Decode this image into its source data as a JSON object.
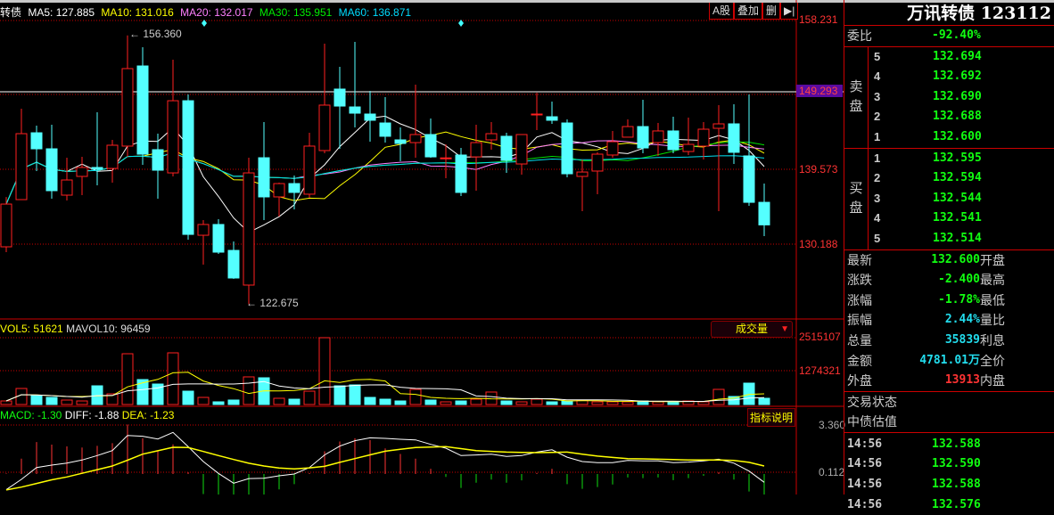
{
  "header": {
    "prefix": "转债",
    "ma": [
      {
        "label": "MA5: 127.885",
        "color": "#ffffff"
      },
      {
        "label": "MA10: 131.016",
        "color": "#ffff00"
      },
      {
        "label": "MA20: 132.017",
        "color": "#ff80ff"
      },
      {
        "label": "MA30: 135.951",
        "color": "#00e000"
      },
      {
        "label": "MA60: 136.871",
        "color": "#00e0f0"
      }
    ]
  },
  "toolbar": {
    "a_share": "A股",
    "overlay": "叠加",
    "delete": "删",
    "expand_icon": "▶|"
  },
  "price_axis": {
    "p1": "158.231",
    "p2": "149.293",
    "p3": "139.573",
    "p4": "130.188"
  },
  "annotations": {
    "high": "156.360",
    "low": "122.675"
  },
  "volume": {
    "legend_vol5": "VOL5: 51621",
    "legend_mavol10": "MAVOL10: 96459",
    "selector": "成交量",
    "axis_top": "2515107",
    "axis_mid": "1274321"
  },
  "macd": {
    "legend_macd": "MACD: -1.30",
    "legend_diff": "DIFF: -1.88",
    "legend_dea": "DEA: -1.23",
    "help_button": "指标说明",
    "axis_top": "3.360",
    "axis_mid": "0.112"
  },
  "colors": {
    "up": "#ff2020",
    "down": "#54ffff",
    "ma5": "#ffffff",
    "ma10": "#ffff00",
    "ma20": "#ff80ff",
    "ma30": "#00e000",
    "ma60": "#00e0f0"
  },
  "chart_data": {
    "type": "candlestick",
    "candles": [
      [
        129.85,
        136.1,
        129.18,
        135.21
      ],
      [
        135.77,
        147.17,
        135.77,
        144.04
      ],
      [
        144.15,
        145.05,
        139.35,
        142.14
      ],
      [
        142.14,
        145.16,
        135.88,
        136.89
      ],
      [
        136.33,
        141.02,
        135.66,
        138.23
      ],
      [
        138.68,
        141.13,
        136.33,
        139.8
      ],
      [
        139.8,
        146.72,
        137.56,
        139.57
      ],
      [
        139.68,
        143.26,
        137.9,
        142.59
      ],
      [
        142.48,
        156.36,
        141.13,
        152.2
      ],
      [
        152.53,
        154.88,
        140.13,
        141.47
      ],
      [
        142.03,
        144.04,
        135.88,
        139.46
      ],
      [
        139.12,
        153.32,
        138.68,
        148.17
      ],
      [
        148.17,
        148.96,
        130.74,
        131.41
      ],
      [
        131.3,
        133.2,
        127.62,
        132.65
      ],
      [
        132.65,
        133.31,
        128.96,
        129.18
      ],
      [
        129.4,
        130.52,
        125.83,
        125.94
      ],
      [
        125.05,
        141.02,
        122.675,
        139.12
      ],
      [
        141.02,
        145.49,
        133.2,
        136.11
      ],
      [
        136.11,
        137.9,
        133.65,
        137.78
      ],
      [
        137.78,
        138.79,
        134.54,
        136.67
      ],
      [
        136.45,
        144.15,
        136.0,
        142.48
      ],
      [
        141.92,
        155.33,
        141.58,
        147.62
      ],
      [
        149.63,
        152.42,
        142.14,
        147.5
      ],
      [
        147.39,
        155.55,
        144.82,
        146.61
      ],
      [
        146.5,
        149.4,
        143.03,
        145.72
      ],
      [
        145.38,
        148.62,
        142.92,
        143.71
      ],
      [
        143.26,
        144.82,
        140.58,
        142.81
      ],
      [
        142.92,
        150.19,
        141.02,
        143.93
      ],
      [
        143.93,
        145.94,
        141.02,
        141.13
      ],
      [
        141.0,
        142.7,
        138.45,
        141.0
      ],
      [
        141.36,
        142.25,
        136.22,
        136.67
      ],
      [
        141.13,
        145.16,
        136.89,
        142.92
      ],
      [
        143.26,
        145.49,
        142.03,
        144.04
      ],
      [
        143.71,
        144.15,
        139.12,
        140.69
      ],
      [
        140.24,
        143.93,
        138.9,
        143.93
      ],
      [
        146.5,
        149.17,
        144.49,
        146.5
      ],
      [
        146.16,
        148.06,
        145.27,
        145.72
      ],
      [
        145.38,
        145.83,
        138.57,
        139.01
      ],
      [
        138.68,
        140.8,
        134.32,
        139.23
      ],
      [
        139.35,
        141.7,
        136.45,
        141.47
      ],
      [
        141.36,
        144.38,
        141.02,
        143.03
      ],
      [
        143.6,
        145.83,
        143.6,
        144.93
      ],
      [
        144.93,
        148.29,
        141.58,
        142.25
      ],
      [
        142.92,
        145.38,
        141.25,
        144.38
      ],
      [
        144.38,
        146.16,
        141.58,
        142.03
      ],
      [
        141.8,
        146.05,
        141.36,
        142.7
      ],
      [
        142.48,
        145.49,
        140.8,
        144.6
      ],
      [
        144.71,
        147.62,
        134.32,
        145.27
      ],
      [
        145.27,
        147.73,
        140.24,
        141.7
      ],
      [
        141.25,
        148.96,
        134.99,
        135.43
      ],
      [
        135.43,
        137.78,
        131.19,
        132.6
      ]
    ],
    "volumes": [
      134000,
      604000,
      335000,
      268000,
      168000,
      134000,
      704000,
      402000,
      1911000,
      939000,
      771000,
      1945000,
      503000,
      268000,
      101000,
      168000,
      1040000,
      1006000,
      235000,
      201000,
      503000,
      2515000,
      704000,
      738000,
      268000,
      201000,
      134000,
      570000,
      168000,
      101000,
      134000,
      201000,
      470000,
      134000,
      101000,
      201000,
      101000,
      134000,
      168000,
      101000,
      101000,
      101000,
      134000,
      101000,
      101000,
      134000,
      101000,
      570000,
      302000,
      805000,
      235000
    ],
    "diff": [
      -1.08,
      -0.37,
      0.45,
      0.61,
      0.75,
      0.96,
      1.27,
      1.61,
      2.65,
      2.6,
      2.41,
      2.86,
      1.88,
      0.86,
      0.04,
      -0.63,
      -0.31,
      -0.29,
      -0.12,
      0.0,
      0.45,
      1.31,
      1.92,
      2.29,
      2.49,
      2.45,
      2.39,
      2.35,
      2.04,
      1.78,
      1.27,
      1.31,
      1.37,
      1.21,
      1.27,
      1.51,
      1.67,
      1.16,
      0.86,
      0.78,
      0.78,
      0.94,
      0.9,
      0.9,
      0.78,
      0.82,
      0.9,
      1.02,
      0.75,
      0.2,
      -0.57
    ],
    "dea": [
      -1.1,
      -0.9,
      -0.65,
      -0.4,
      -0.2,
      0.05,
      0.3,
      0.55,
      0.95,
      1.37,
      1.6,
      1.84,
      1.82,
      1.55,
      1.27,
      1.0,
      0.74,
      0.55,
      0.41,
      0.35,
      0.42,
      0.53,
      0.8,
      1.06,
      1.32,
      1.57,
      1.7,
      1.82,
      1.86,
      1.88,
      1.75,
      1.61,
      1.56,
      1.51,
      1.49,
      1.47,
      1.49,
      1.51,
      1.37,
      1.23,
      1.14,
      1.06,
      1.04,
      1.02,
      0.99,
      0.96,
      0.96,
      0.96,
      0.94,
      0.8,
      0.55
    ],
    "price_range": [
      122.0,
      158.231
    ]
  },
  "panel": {
    "title": "万讯转债 123112",
    "weibi_label": "委比",
    "weibi_value": "-92.40%",
    "sell_label": [
      "卖",
      "盘"
    ],
    "sell": [
      {
        "n": "5",
        "p": "132.694"
      },
      {
        "n": "4",
        "p": "132.692"
      },
      {
        "n": "3",
        "p": "132.690"
      },
      {
        "n": "2",
        "p": "132.688"
      },
      {
        "n": "1",
        "p": "132.600"
      }
    ],
    "buy_label": [
      "买",
      "盘"
    ],
    "buy": [
      {
        "n": "1",
        "p": "132.595"
      },
      {
        "n": "2",
        "p": "132.594"
      },
      {
        "n": "3",
        "p": "132.544"
      },
      {
        "n": "4",
        "p": "132.541"
      },
      {
        "n": "5",
        "p": "132.514"
      }
    ],
    "info": [
      {
        "l": "最新",
        "v": "132.600",
        "r": "开盘",
        "c": "grn"
      },
      {
        "l": "涨跌",
        "v": "-2.400",
        "r": "最高",
        "c": "grn"
      },
      {
        "l": "涨幅",
        "v": "-1.78%",
        "r": "最低",
        "c": "grn"
      },
      {
        "l": "振幅",
        "v": "2.44%",
        "r": "量比",
        "c": "cyan"
      },
      {
        "l": "总量",
        "v": "35839",
        "r": "利息",
        "c": "cyan"
      },
      {
        "l": "金额",
        "v": "4781.01万",
        "r": "全价",
        "c": "cyan"
      },
      {
        "l": "外盘",
        "v": "13913",
        "r": "内盘",
        "c": "red"
      }
    ],
    "state": [
      "交易状态",
      "中债估值"
    ],
    "ticks": [
      {
        "t": "14:56",
        "p": "132.588"
      },
      {
        "t": "14:56",
        "p": "132.590"
      },
      {
        "t": "14:56",
        "p": "132.588"
      },
      {
        "t": "14:56",
        "p": "132.576"
      }
    ]
  }
}
